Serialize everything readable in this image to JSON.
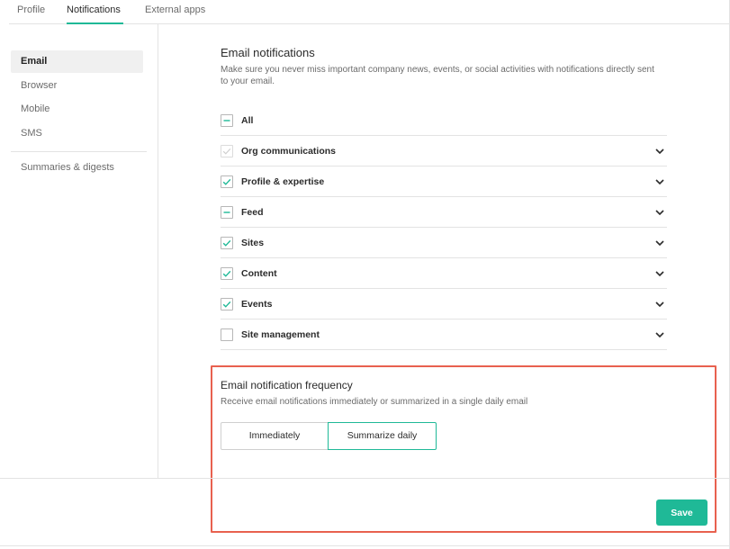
{
  "tabs": [
    {
      "label": "Profile",
      "active": false
    },
    {
      "label": "Notifications",
      "active": true
    },
    {
      "label": "External apps",
      "active": false
    }
  ],
  "sidebar": {
    "items": [
      {
        "label": "Email",
        "active": true
      },
      {
        "label": "Browser",
        "active": false
      },
      {
        "label": "Mobile",
        "active": false
      },
      {
        "label": "SMS",
        "active": false
      },
      {
        "label": "Summaries & digests",
        "active": false
      }
    ]
  },
  "email": {
    "title": "Email notifications",
    "description": "Make sure you never miss important company news, events, or social activities with notifications directly sent to your email.",
    "rows": [
      {
        "label": "All",
        "state": "indeterminate",
        "expandable": false
      },
      {
        "label": "Org communications",
        "state": "checked-disabled",
        "expandable": true
      },
      {
        "label": "Profile & expertise",
        "state": "checked",
        "expandable": true
      },
      {
        "label": "Feed",
        "state": "indeterminate",
        "expandable": true
      },
      {
        "label": "Sites",
        "state": "checked",
        "expandable": true
      },
      {
        "label": "Content",
        "state": "checked",
        "expandable": true
      },
      {
        "label": "Events",
        "state": "checked",
        "expandable": true
      },
      {
        "label": "Site management",
        "state": "unchecked",
        "expandable": true
      }
    ]
  },
  "frequency": {
    "title": "Email notification frequency",
    "description": "Receive email notifications immediately or summarized in a single daily email",
    "options": [
      {
        "label": "Immediately",
        "selected": false
      },
      {
        "label": "Summarize daily",
        "selected": true
      }
    ]
  },
  "footer": {
    "save_label": "Save"
  },
  "colors": {
    "accent": "#1fb997",
    "highlight": "#e8614f"
  }
}
